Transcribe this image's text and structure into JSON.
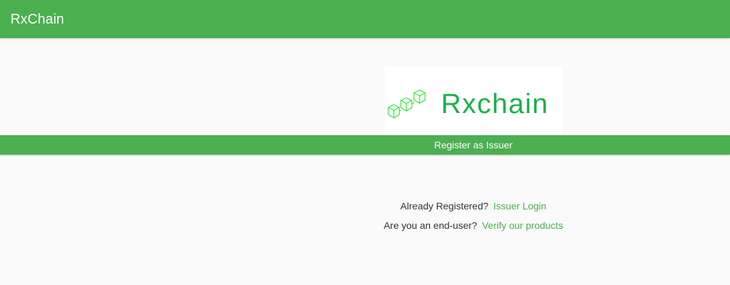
{
  "header": {
    "title": "RxChain",
    "color": "#4caf50"
  },
  "logo": {
    "wordmark": "Rxchain",
    "icon": "cubes-chain-icon",
    "color": "#18b24a"
  },
  "register": {
    "label": "Register as Issuer"
  },
  "login_prompt": {
    "question": "Already Registered?",
    "link": "Issuer Login"
  },
  "verify_prompt": {
    "question": "Are you an end-user?",
    "link": "Verify our products"
  },
  "colors": {
    "accent": "#4caf50",
    "background": "#fafafa",
    "text": "#333333"
  }
}
